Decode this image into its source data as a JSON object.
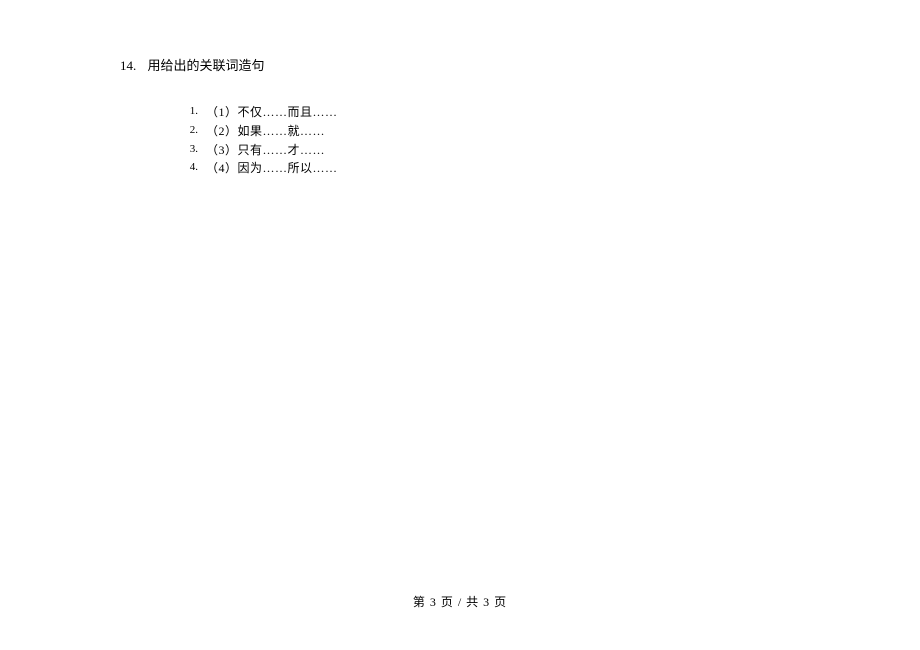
{
  "question": {
    "number": "14.",
    "title": "用给出的关联词造句"
  },
  "items": [
    {
      "marker": "1.",
      "text": "（1）不仅……而且……"
    },
    {
      "marker": "2.",
      "text": "（2）如果……就……"
    },
    {
      "marker": "3.",
      "text": "（3）只有……才……"
    },
    {
      "marker": "4.",
      "text": "（4）因为……所以……"
    }
  ],
  "footer": "第 3 页  /  共 3 页"
}
